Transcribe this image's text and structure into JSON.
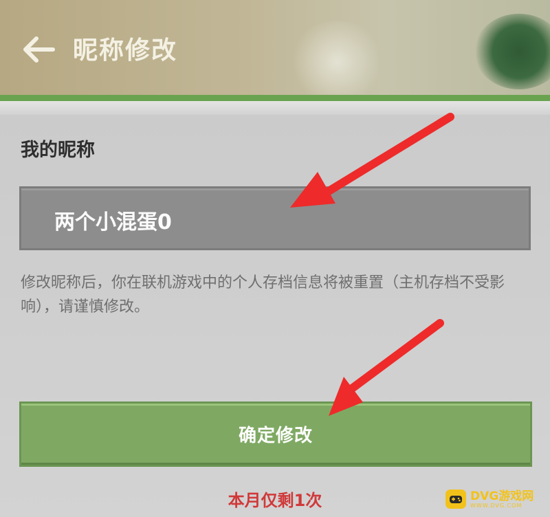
{
  "header": {
    "title": "昵称修改",
    "back_icon": "back-arrow-icon"
  },
  "form": {
    "section_label": "我的昵称",
    "nickname_value": "两个小混蛋0",
    "notice": "修改昵称后，你在联机游戏中的个人存档信息将被重置（主机存档不受影响），请谨慎修改。",
    "confirm_label": "确定修改",
    "remaining_text": "本月仅剩1次"
  },
  "watermark": {
    "name": "DVG游戏网",
    "sub": "WWW.DVG.COM"
  },
  "colors": {
    "accent_green": "#7fa963",
    "warning_red": "#d0393a",
    "annotation_arrow": "#ee2a2a"
  }
}
